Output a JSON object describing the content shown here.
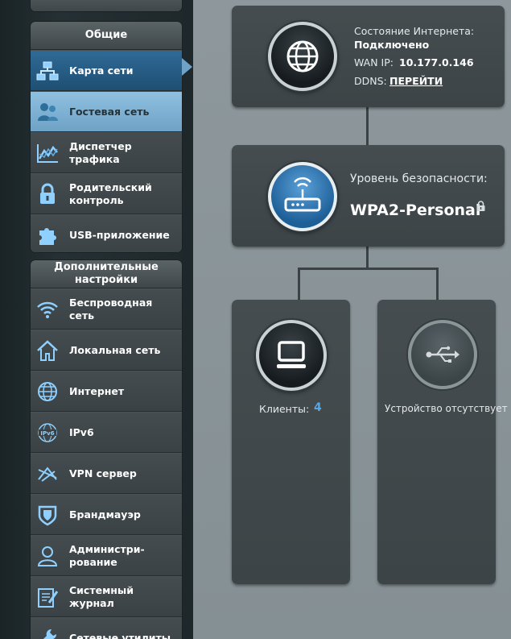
{
  "sidebar": {
    "general": {
      "title": "Общие",
      "items": [
        {
          "label": "Карта сети",
          "icon": "network-map-icon"
        },
        {
          "label": "Гостевая сеть",
          "icon": "guest-network-icon"
        },
        {
          "label": "Диспетчер трафика",
          "icon": "traffic-manager-icon"
        },
        {
          "label": "Родительский контроль",
          "icon": "lock-icon"
        },
        {
          "label": "USB-приложение",
          "icon": "puzzle-icon"
        }
      ]
    },
    "advanced": {
      "title": "Дополнительные настройки",
      "items": [
        {
          "label": "Беспроводная сеть",
          "icon": "wifi-icon"
        },
        {
          "label": "Локальная сеть",
          "icon": "home-icon"
        },
        {
          "label": "Интернет",
          "icon": "globe-icon"
        },
        {
          "label": "IPv6",
          "icon": "ipv6-globe-icon"
        },
        {
          "label": "VPN сервер",
          "icon": "vpn-icon"
        },
        {
          "label": "Брандмауэр",
          "icon": "shield-icon"
        },
        {
          "label": "Администри-рование",
          "icon": "user-admin-icon"
        },
        {
          "label": "Системный журнал",
          "icon": "log-icon"
        },
        {
          "label": "Сетевые утилиты",
          "icon": "wrench-icon"
        }
      ]
    }
  },
  "internet": {
    "status_label": "Состояние Интернета:",
    "status_value": "Подключено",
    "wan_label": "WAN IP:",
    "wan_ip": "10.177.0.146",
    "ddns_label": "DDNS:",
    "ddns_link": "ПЕРЕЙТИ"
  },
  "router": {
    "security_label": "Уровень безопасности:",
    "security_value": "WPA2-Personal"
  },
  "clients": {
    "label": "Клиенты:",
    "count": "4"
  },
  "usb": {
    "status": "Устройство отсутствует"
  },
  "colors": {
    "accent_blue": "#2f6a96",
    "hover_blue": "#8fc0e0",
    "clients_count": "#5aa6e0"
  }
}
